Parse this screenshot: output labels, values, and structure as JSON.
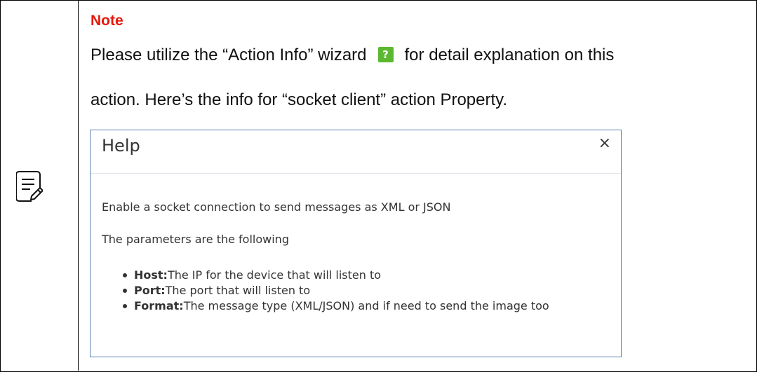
{
  "note": {
    "title": "Note",
    "line1_before": "Please utilize the “Action Info” wizard",
    "help_icon_glyph": "?",
    "line1_after": "for detail explanation on this",
    "line2": "action. Here’s the info for “socket client” action Property."
  },
  "help_dialog": {
    "title": "Help",
    "close_glyph": "×",
    "description": "Enable a socket connection to send messages as XML or JSON",
    "params_intro": "The parameters are the following",
    "params": [
      {
        "name": "Host:",
        "text": "The IP for the device that will listen to"
      },
      {
        "name": "Port:",
        "text": "The port that will listen to"
      },
      {
        "name": "Format:",
        "text": "The message type (XML/JSON) and if need to send the image too"
      }
    ]
  },
  "icons": {
    "left": "note-pencil-icon",
    "help": "question-mark-icon",
    "close": "close-icon"
  },
  "colors": {
    "note_title": "#e4190b",
    "help_icon_bg": "#5cb830",
    "dialog_border": "#5b7fb5"
  }
}
